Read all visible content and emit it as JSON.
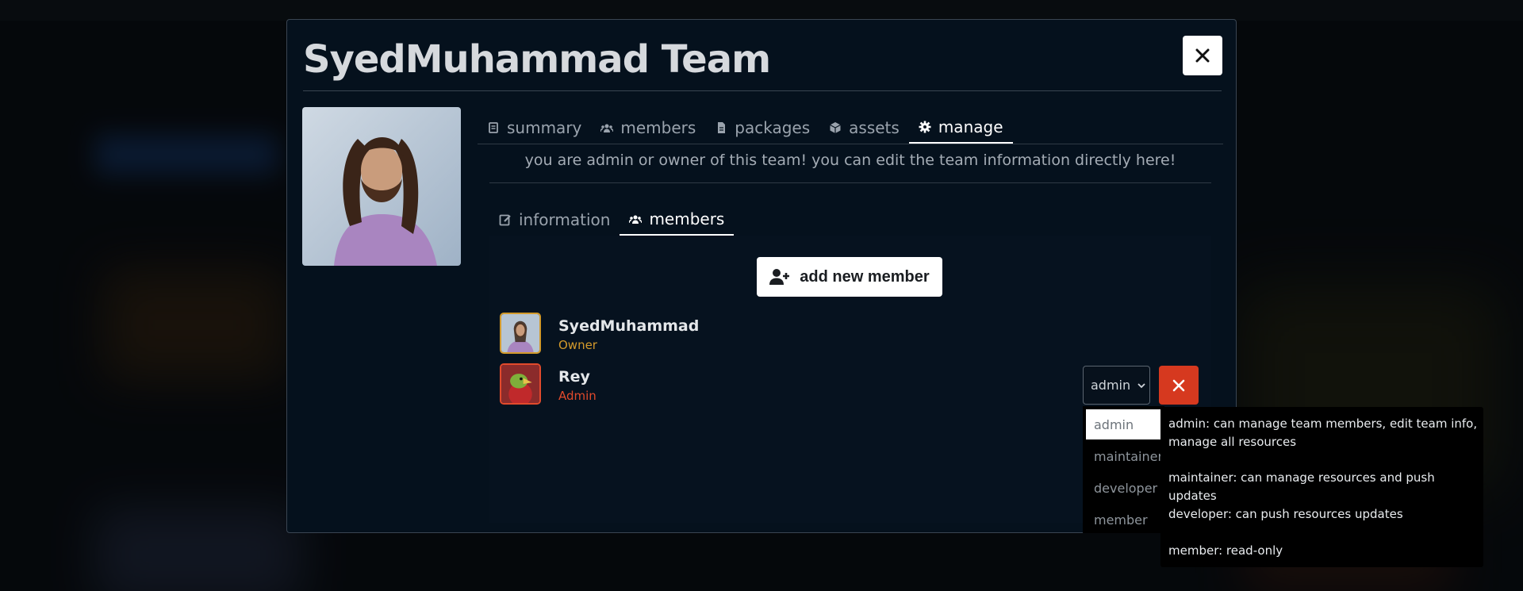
{
  "modal": {
    "title": "SyedMuhammad Team",
    "close_icon": "close-icon"
  },
  "tabs": [
    {
      "label": "summary",
      "icon": "document-icon",
      "active": false
    },
    {
      "label": "members",
      "icon": "users-icon",
      "active": false
    },
    {
      "label": "packages",
      "icon": "file-icon",
      "active": false
    },
    {
      "label": "assets",
      "icon": "cube-icon",
      "active": false
    },
    {
      "label": "manage",
      "icon": "gear-icon",
      "active": true
    }
  ],
  "notice": "you are admin or owner of this team! you can edit the team information directly here!",
  "subtabs": [
    {
      "label": "information",
      "icon": "edit-icon",
      "active": false
    },
    {
      "label": "members",
      "icon": "users-icon",
      "active": true
    }
  ],
  "add_member_label": "add new member",
  "members": [
    {
      "name": "SyedMuhammad",
      "role": "Owner",
      "role_color": "#d39a2b",
      "avatar": "portrait-avatar"
    },
    {
      "name": "Rey",
      "role": "Admin",
      "role_color": "#e24a2c",
      "avatar": "bird-avatar"
    }
  ],
  "role_select": {
    "value": "admin"
  },
  "role_options": [
    "admin",
    "maintainer",
    "developer",
    "member"
  ],
  "role_help": [
    "admin: can manage team members, edit team info, manage all resources",
    "maintainer: can manage resources and push updates",
    "developer: can push resources updates",
    "member: read-only"
  ],
  "colors": {
    "modal_bg": "#05111d",
    "owner": "#d39a2b",
    "admin": "#e24a2c",
    "danger_button": "#d6391f"
  }
}
